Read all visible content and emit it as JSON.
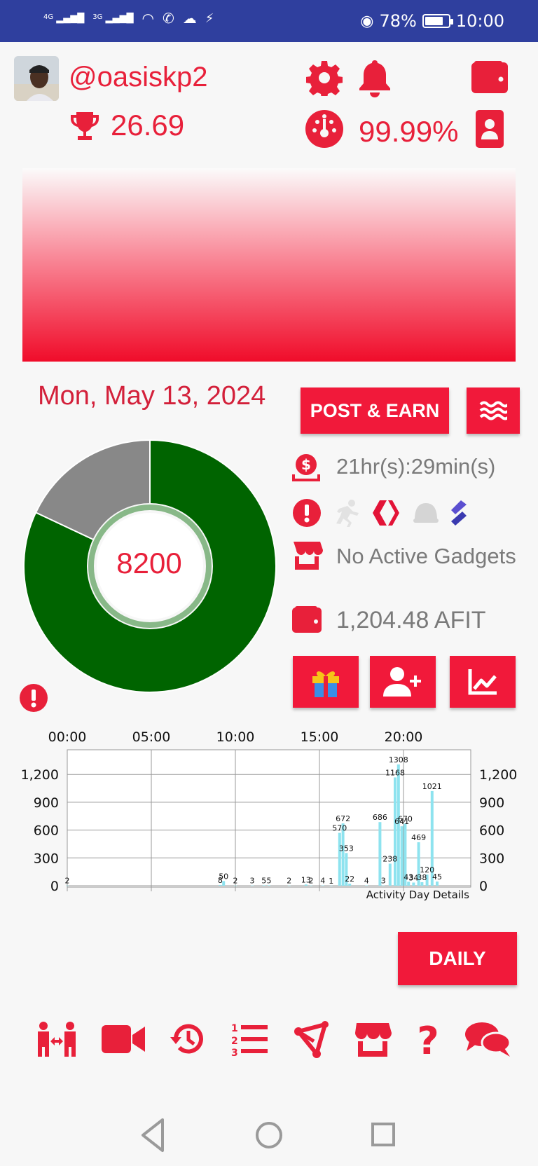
{
  "status_bar": {
    "network_1": "4G",
    "network_2": "3G",
    "battery_percent": "78%",
    "battery_level": 0.78,
    "time": "10:00"
  },
  "profile": {
    "username": "@oasiskp2",
    "trophy_value": "26.69",
    "efficiency": "99.99%"
  },
  "date": "Mon, May 13, 2024",
  "actions": {
    "post_earn_label": "POST & EARN",
    "daily_label": "DAILY"
  },
  "ring": {
    "value_label": "8200",
    "green_fraction": 0.82,
    "gray_fraction": 0.18,
    "green_color": "#006400",
    "gray_color": "#888888"
  },
  "info": {
    "countdown": "21hr(s):29min(s)",
    "gadgets": "No Active Gadgets",
    "balance": "1,204.48 AFIT"
  },
  "chart_data": {
    "type": "bar",
    "title": "",
    "annotation": "Activity Day Details",
    "x_tick_labels": [
      "00:00",
      "05:00",
      "10:00",
      "15:00",
      "20:00"
    ],
    "y_tick_labels": [
      "0",
      "300",
      "600",
      "900",
      "1,200"
    ],
    "ylim": [
      0,
      1400
    ],
    "x_range_hours": [
      0,
      24
    ],
    "bar_color": "#8ee3ef",
    "series": [
      {
        "values": [
          {
            "h": 0.0,
            "v": 2
          },
          {
            "h": 9.1,
            "v": 8
          },
          {
            "h": 9.3,
            "v": 50
          },
          {
            "h": 10.0,
            "v": 2
          },
          {
            "h": 11.0,
            "v": 3
          },
          {
            "h": 11.7,
            "v": 5
          },
          {
            "h": 12.0,
            "v": 5
          },
          {
            "h": 13.2,
            "v": 2
          },
          {
            "h": 14.2,
            "v": 13
          },
          {
            "h": 14.5,
            "v": 2
          },
          {
            "h": 15.2,
            "v": 4
          },
          {
            "h": 15.7,
            "v": 1
          },
          {
            "h": 16.2,
            "v": 570
          },
          {
            "h": 16.4,
            "v": 672
          },
          {
            "h": 16.6,
            "v": 353
          },
          {
            "h": 16.8,
            "v": 22
          },
          {
            "h": 17.8,
            "v": 4
          },
          {
            "h": 18.6,
            "v": 686
          },
          {
            "h": 18.8,
            "v": 3
          },
          {
            "h": 19.2,
            "v": 238
          },
          {
            "h": 19.5,
            "v": 1168
          },
          {
            "h": 19.7,
            "v": 1308
          },
          {
            "h": 19.9,
            "v": 641
          },
          {
            "h": 20.1,
            "v": 670
          },
          {
            "h": 20.3,
            "v": 43
          },
          {
            "h": 20.6,
            "v": 34
          },
          {
            "h": 20.9,
            "v": 469
          },
          {
            "h": 21.1,
            "v": 38
          },
          {
            "h": 21.4,
            "v": 120
          },
          {
            "h": 21.7,
            "v": 1021
          },
          {
            "h": 22.0,
            "v": 45
          }
        ]
      }
    ],
    "grid": true
  },
  "icons": {
    "settings": "gear-icon",
    "notifications": "bell-icon",
    "wallet_top": "wallet-icon",
    "trophy": "trophy-icon",
    "gauge": "gauge-icon",
    "id_card": "id-card-icon",
    "menu": "waves-menu-icon",
    "money": "money-icon",
    "alert": "alert-icon",
    "store": "store-icon",
    "wallet": "wallet-icon",
    "gift": "gift-icon",
    "add_user": "add-user-icon",
    "stats": "line-chart-icon",
    "bottom_nav": [
      "friends-icon",
      "video-icon",
      "history-icon",
      "leaderboard-icon",
      "share-icon",
      "marketplace-icon",
      "help-icon",
      "chat-icon"
    ]
  },
  "colors": {
    "accent": "#e8203a",
    "status_bar": "#2f3f9e"
  }
}
